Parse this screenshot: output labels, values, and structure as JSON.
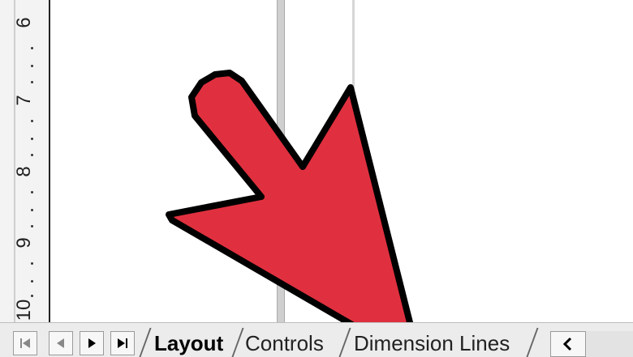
{
  "ruler": {
    "labels": [
      "6",
      "7",
      "8",
      "9",
      "10"
    ]
  },
  "tabs": {
    "layout": "Layout",
    "controls": "Controls",
    "dimension_lines": "Dimension Lines"
  },
  "nav": {
    "first_icon": "skip-first-icon",
    "prev_icon": "prev-icon",
    "next_icon": "next-icon",
    "last_icon": "skip-last-icon",
    "scroll_left_icon": "chevron-left-icon"
  },
  "colors": {
    "arrow_fill": "#e0303f",
    "arrow_outline": "#000000",
    "canvas": "#ffffff"
  }
}
